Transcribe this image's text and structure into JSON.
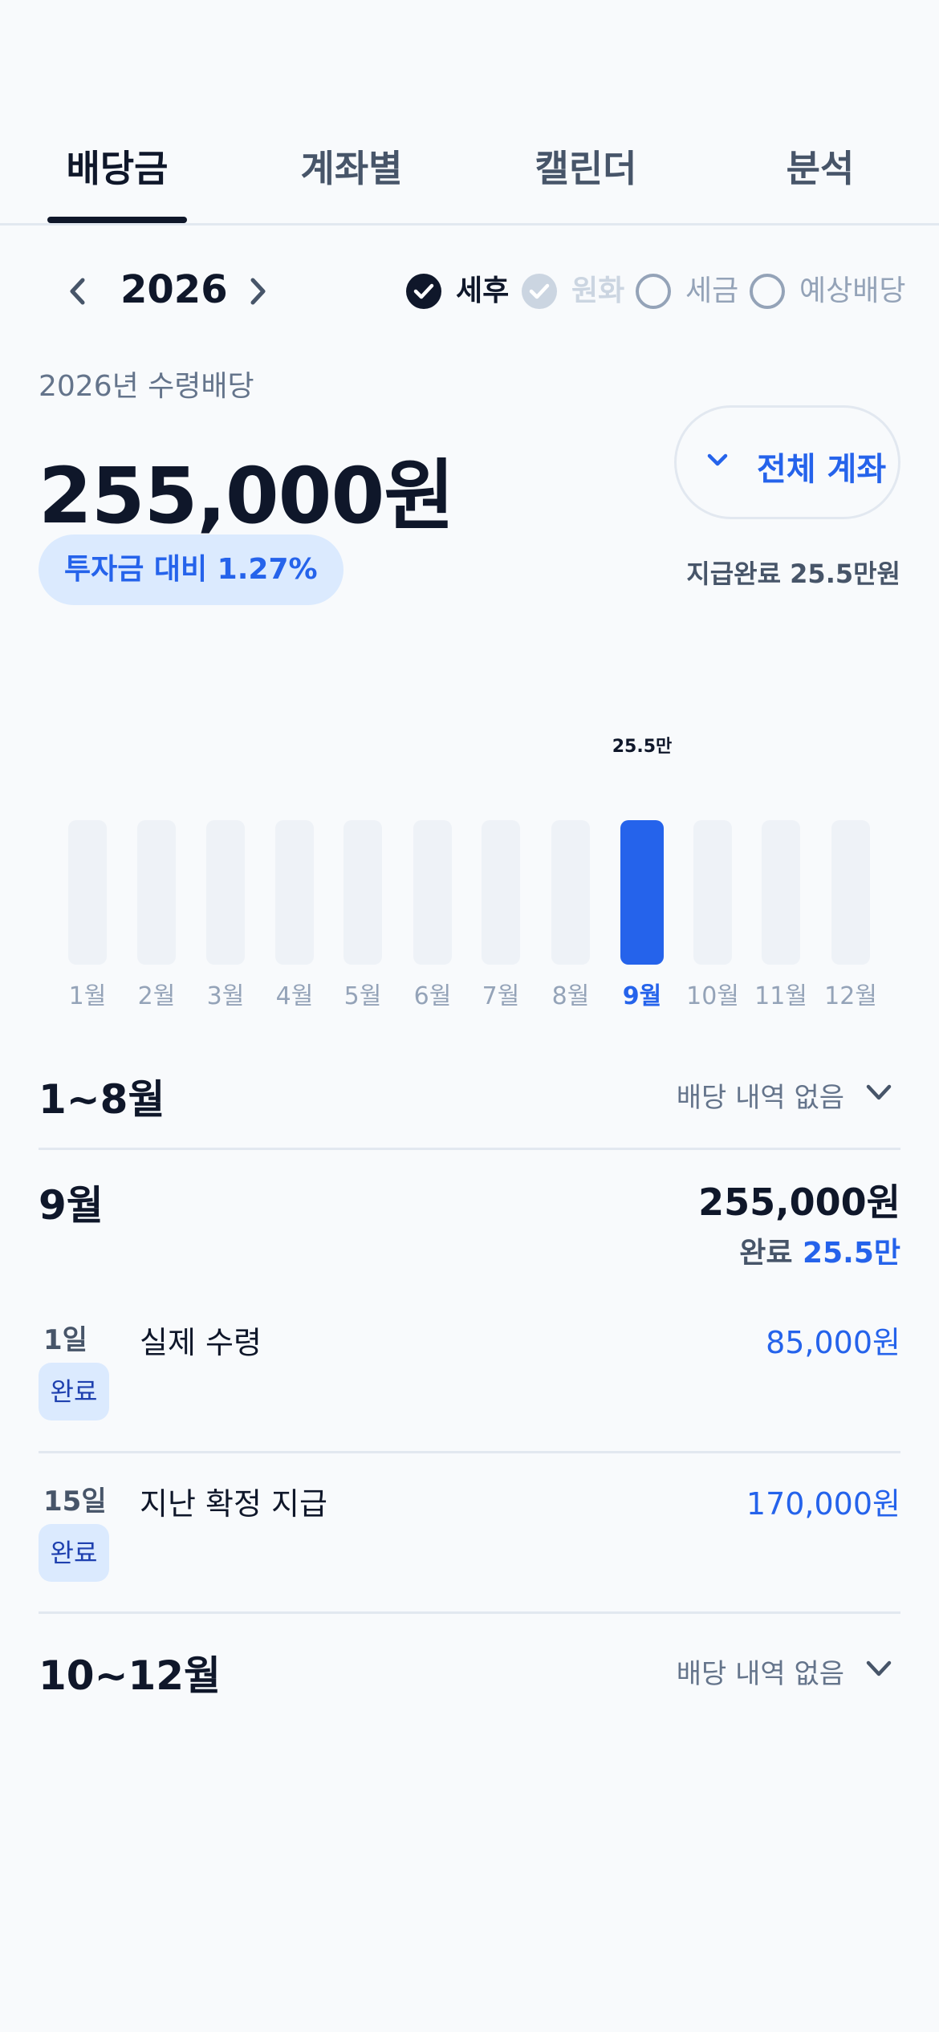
{
  "tabs": [
    {
      "label": "배당금",
      "active": true
    },
    {
      "label": "계좌별",
      "active": false
    },
    {
      "label": "캘린더",
      "active": false
    },
    {
      "label": "분석",
      "active": false
    }
  ],
  "year": "2026",
  "options": [
    {
      "label": "세후",
      "state": "checked"
    },
    {
      "label": "원화",
      "state": "disabled-checked"
    },
    {
      "label": "세금",
      "state": "unchecked"
    },
    {
      "label": "예상배당",
      "state": "unchecked"
    }
  ],
  "summary": {
    "sub_label": "2026년 수령배당",
    "amount": "255,000원",
    "account_button": "전체 계좌",
    "ratio_badge": "투자금 대비 1.27%",
    "paid_done": "지급완료 25.5만원"
  },
  "chart_data": {
    "type": "bar",
    "categories": [
      "1월",
      "2월",
      "3월",
      "4월",
      "5월",
      "6월",
      "7월",
      "8월",
      "9월",
      "10월",
      "11월",
      "12월"
    ],
    "values": [
      0,
      0,
      0,
      0,
      0,
      0,
      0,
      0,
      25.5,
      0,
      0,
      0
    ],
    "data_labels": [
      "",
      "",
      "",
      "",
      "",
      "",
      "",
      "",
      "25.5만",
      "",
      "",
      ""
    ],
    "selected_index": 8,
    "colors": {
      "selected": "#2563eb",
      "empty": "#eef2f7"
    }
  },
  "sections": {
    "early": {
      "title": "1~8월",
      "status": "배당 내역 없음"
    },
    "sept": {
      "title": "9월",
      "total": "255,000원",
      "done_label": "완료",
      "done_value": "25.5만",
      "entries": [
        {
          "day": "1일",
          "desc": "실제 수령",
          "amount": "85,000원",
          "status": "완료"
        },
        {
          "day": "15일",
          "desc": "지난 확정 지급",
          "amount": "170,000원",
          "status": "완료"
        }
      ]
    },
    "late": {
      "title": "10~12월",
      "status": "배당 내역 없음"
    }
  }
}
